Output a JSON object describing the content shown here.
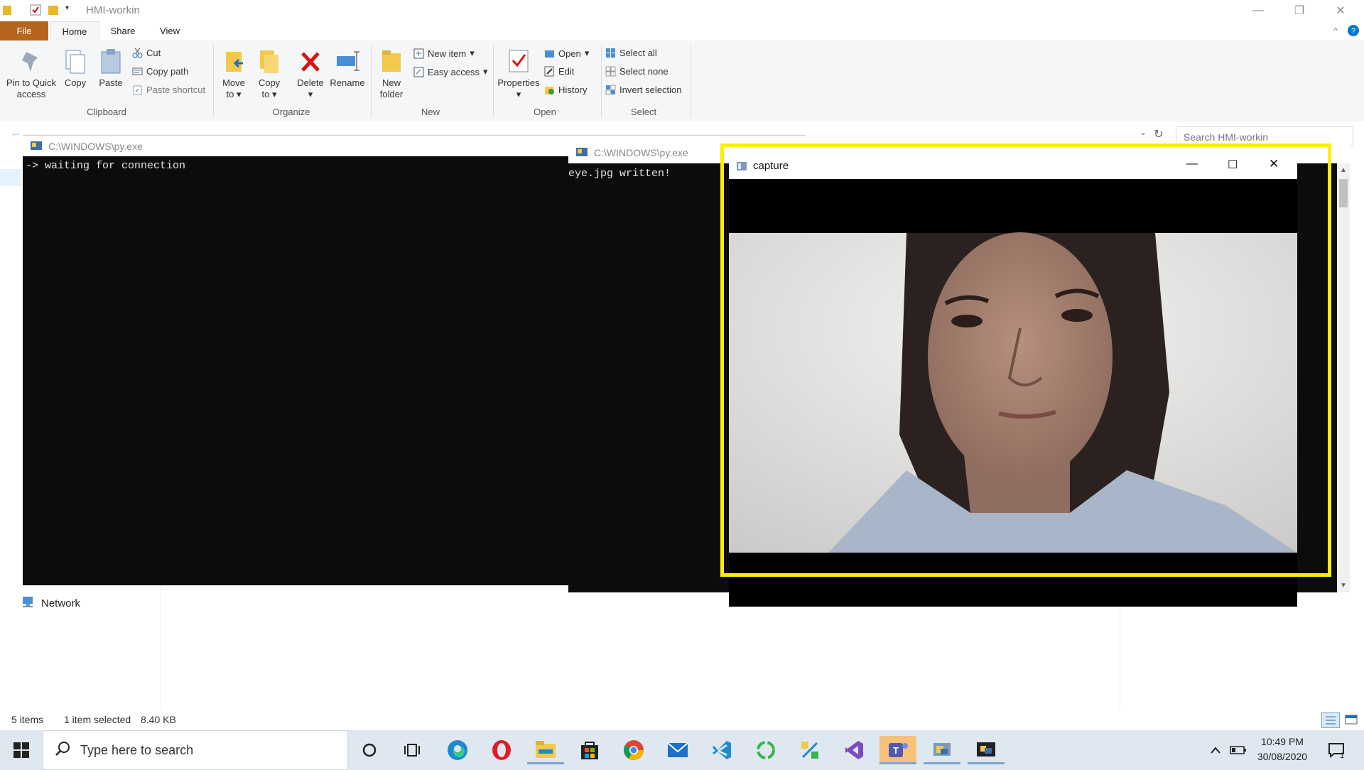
{
  "explorer": {
    "title": "HMI-workin",
    "tabs": {
      "file": "File",
      "home": "Home",
      "share": "Share",
      "view": "View"
    },
    "ribbon": {
      "clipboard": {
        "pin": "Pin to Quick access",
        "copy": "Copy",
        "paste": "Paste",
        "cut": "Cut",
        "copy_path": "Copy path",
        "paste_shortcut": "Paste shortcut",
        "label": "Clipboard"
      },
      "organize": {
        "move_to": "Move to",
        "copy_to": "Copy to",
        "delete": "Delete",
        "rename": "Rename",
        "label": "Organize"
      },
      "new": {
        "new_folder": "New folder",
        "new_item": "New item",
        "easy_access": "Easy access",
        "label": "New"
      },
      "open": {
        "properties": "Properties",
        "open": "Open",
        "edit": "Edit",
        "history": "History",
        "label": "Open"
      },
      "select": {
        "select_all": "Select all",
        "select_none": "Select none",
        "invert": "Invert selection",
        "label": "Select"
      }
    },
    "search_placeholder": "Search HMI-workin",
    "nav": {
      "network": "Network"
    },
    "status": {
      "items": "5 items",
      "selected": "1 item selected",
      "size": "8.40 KB"
    }
  },
  "console1": {
    "title": "C:\\WINDOWS\\py.exe",
    "output": "-> waiting for connection"
  },
  "console2": {
    "title": "C:\\WINDOWS\\py.exe",
    "output": "eye.jpg written!"
  },
  "capture": {
    "title": "capture"
  },
  "taskbar": {
    "search_placeholder": "Type here to search",
    "time": "10:49 PM",
    "date": "30/08/2020",
    "notifications": "1"
  },
  "colors": {
    "highlight": "#ffee00",
    "file_tab": "#b5651d",
    "accent": "#0078d7"
  }
}
